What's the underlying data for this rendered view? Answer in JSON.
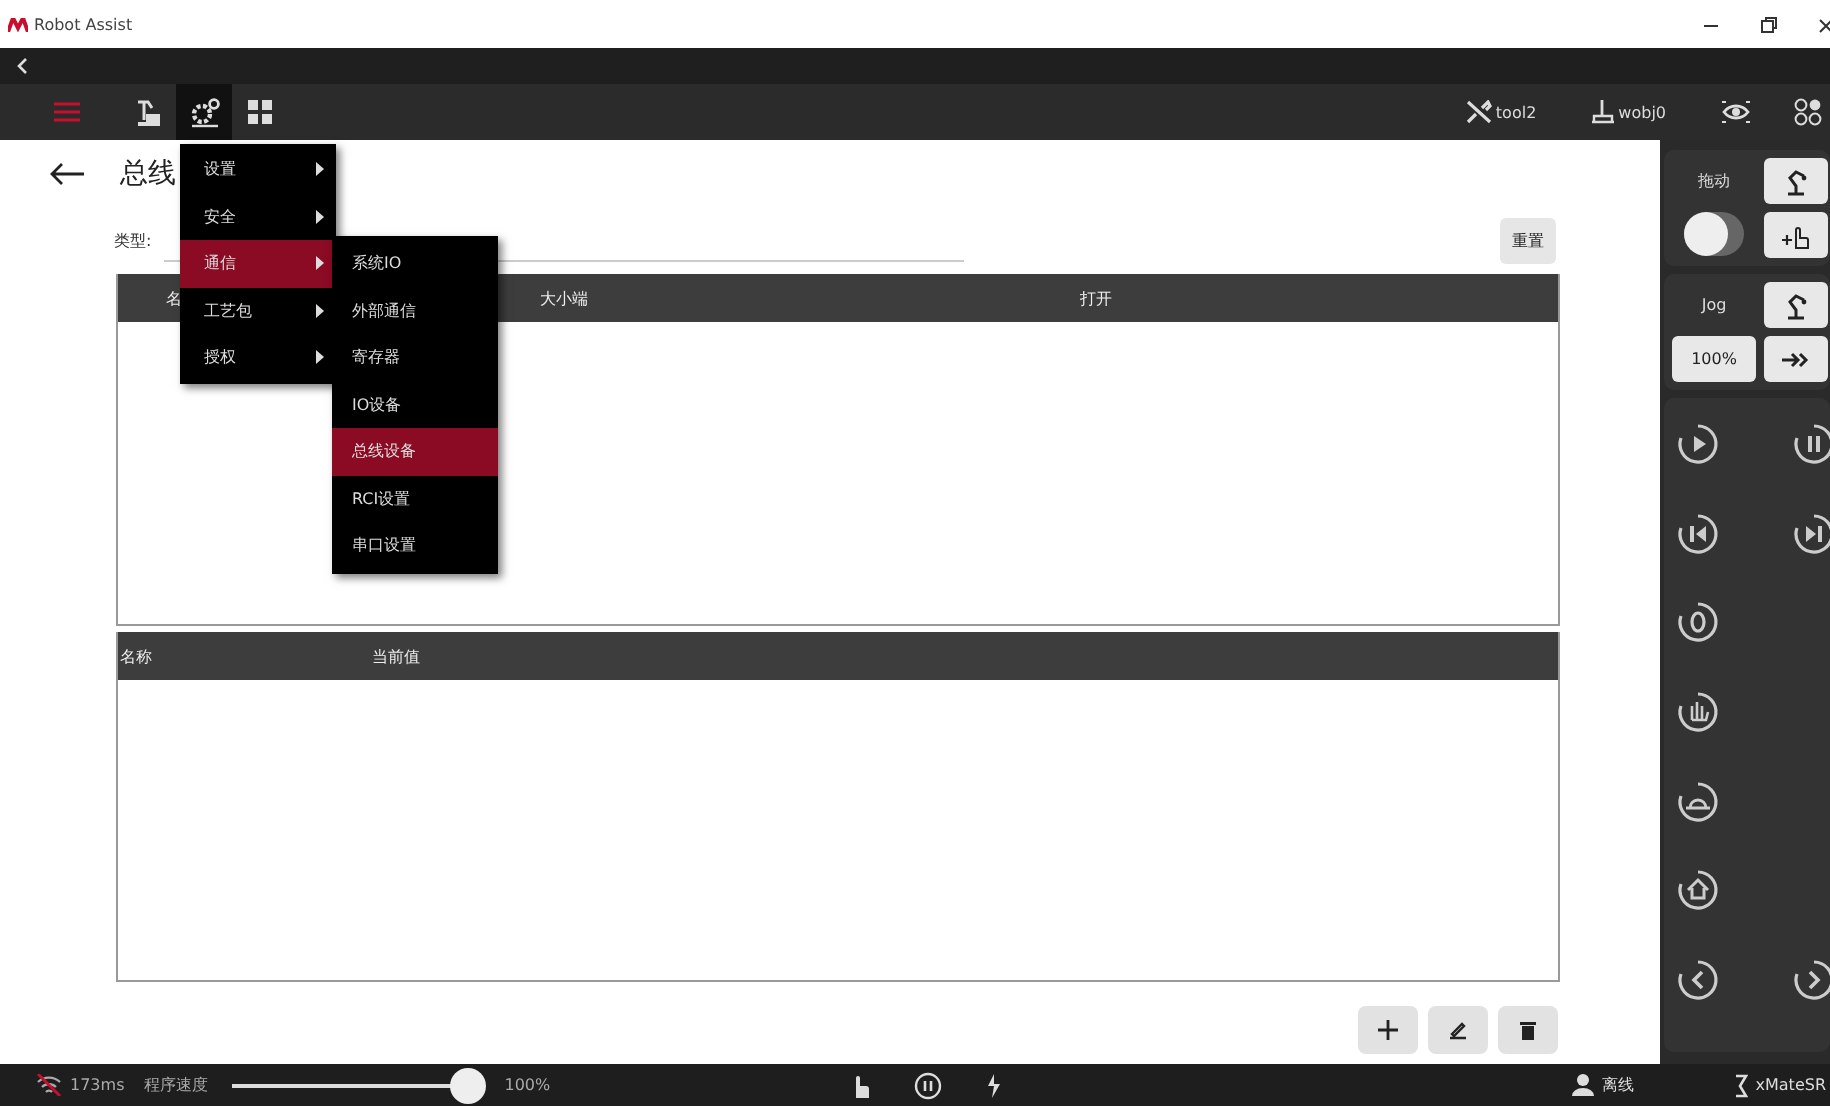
{
  "app": {
    "title": "Robot Assist"
  },
  "toolbar": {
    "tabs": [
      {
        "kind": "robot",
        "selected": false
      },
      {
        "kind": "settings",
        "selected": true
      },
      {
        "kind": "grid",
        "selected": false
      }
    ],
    "tool": "tool2",
    "wobj": "wobj0"
  },
  "menu": {
    "items": [
      {
        "label": "设置",
        "selected": false
      },
      {
        "label": "安全",
        "selected": false
      },
      {
        "label": "通信",
        "selected": true
      },
      {
        "label": "工艺包",
        "selected": false
      },
      {
        "label": "授权",
        "selected": false
      }
    ]
  },
  "submenu": {
    "items": [
      {
        "label": "系统IO",
        "selected": false
      },
      {
        "label": "外部通信",
        "selected": false
      },
      {
        "label": "寄存器",
        "selected": false
      },
      {
        "label": "IO设备",
        "selected": false
      },
      {
        "label": "总线设备",
        "selected": true
      },
      {
        "label": "RCI设置",
        "selected": false
      },
      {
        "label": "串口设置",
        "selected": false
      }
    ]
  },
  "page": {
    "title": "总线",
    "type_label": "类型:",
    "reset_button": "重置"
  },
  "table_top": {
    "columns": [
      "名",
      "大小端",
      "打开"
    ]
  },
  "table_bottom": {
    "columns": [
      "名称",
      "当前值"
    ]
  },
  "action_buttons": [
    {
      "kind": "add"
    },
    {
      "kind": "edit"
    },
    {
      "kind": "delete"
    }
  ],
  "right_panel": {
    "drag_label": "拖动",
    "drag_on": false,
    "jog_label": "Jog",
    "jog_speed": "100%",
    "control_rows": [
      {
        "controls": [
          {
            "kind": "play"
          },
          {
            "kind": "pause"
          }
        ]
      },
      {
        "controls": [
          {
            "kind": "step-back"
          },
          {
            "kind": "step-forward"
          }
        ]
      },
      {
        "controls": [
          {
            "kind": "zero"
          }
        ]
      },
      {
        "controls": [
          {
            "kind": "hand"
          }
        ]
      },
      {
        "controls": [
          {
            "kind": "ground"
          }
        ]
      },
      {
        "controls": [
          {
            "kind": "home"
          }
        ]
      },
      {
        "controls": [
          {
            "kind": "left"
          },
          {
            "kind": "right"
          }
        ]
      }
    ]
  },
  "status_bar": {
    "latency": "173ms",
    "speed_label": "程序速度",
    "speed": {
      "level": 1.0
    },
    "speed_text": "100%",
    "user": "离线",
    "robot": "xMateSR"
  }
}
